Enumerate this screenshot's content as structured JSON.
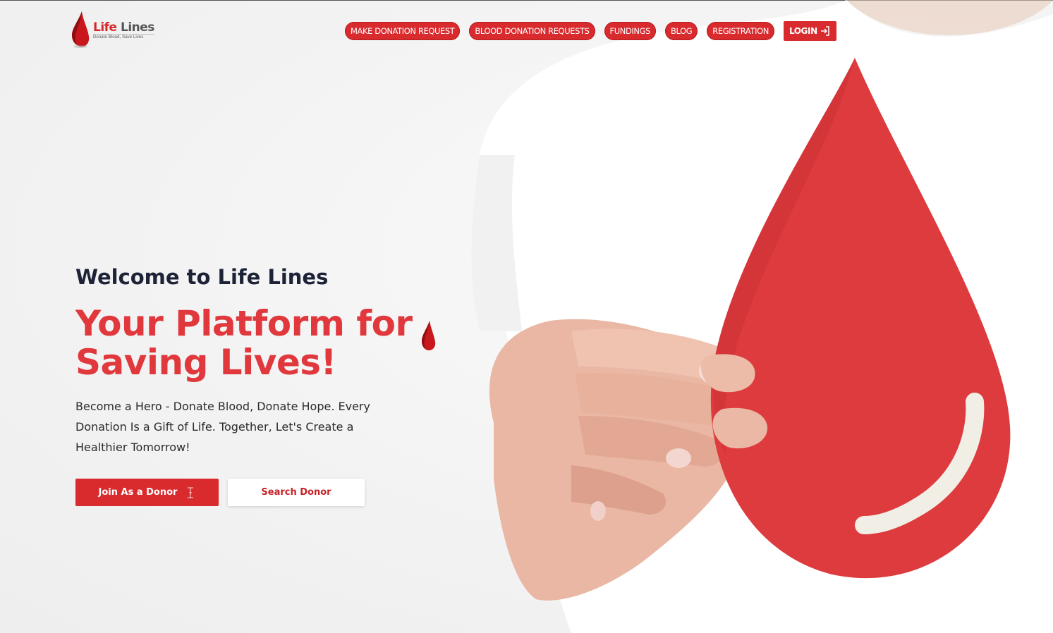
{
  "brand": {
    "name_part1": "Life",
    "name_part2": "Lines",
    "tagline": "Donate Blood, Save Lives",
    "logo_icon": "blood-drop-icon"
  },
  "nav": {
    "items": [
      {
        "label": "MAKE DONATION REQUEST"
      },
      {
        "label": "BLOOD DONATION REQUESTS"
      },
      {
        "label": "FUNDINGS"
      },
      {
        "label": "BLOG"
      },
      {
        "label": "REGISTRATION"
      }
    ],
    "login_label": "LOGIN",
    "login_icon": "login-arrow-icon"
  },
  "hero": {
    "welcome": "Welcome to Life Lines",
    "headline": "Your Platform for Saving Lives!",
    "description": "Become a Hero - Donate Blood, Donate Hope. Every Donation Is a Gift of Life. Together, Let's Create a Healthier Tomorrow!",
    "primary_button": "Join As a Donor",
    "primary_button_icon": "text-cursor-icon",
    "secondary_button": "Search Donor"
  },
  "colors": {
    "brand_red": "#d92a2e",
    "headline_red": "#e0383c",
    "dark_text": "#1d2337"
  }
}
